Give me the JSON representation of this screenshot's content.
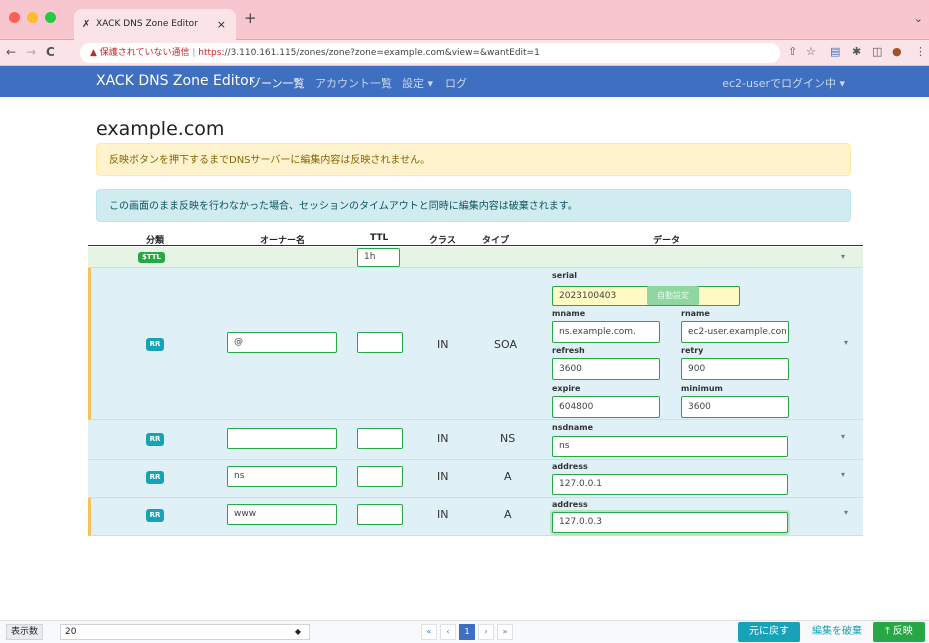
{
  "browser": {
    "tab_title": "XACK DNS Zone Editor",
    "tab_close": "×",
    "new_tab": "+",
    "warning": "保護されていない通信",
    "url_https": "https",
    "url_rest": "://3.110.161.115/zones/zone?zone=example.com&view=&wantEdit=1",
    "back": "←",
    "forward": "→",
    "reload": "C"
  },
  "nav": {
    "brand": "XACK DNS Zone Editor",
    "links": [
      "ゾーン一覧",
      "アカウント一覧",
      "設定 ▾",
      "ログ"
    ],
    "user": "ec2-userでログイン中 ▾"
  },
  "page": {
    "title": "example.com",
    "alert_warning": "反映ボタンを押下するまでDNSサーバーに編集内容は反映されません。",
    "alert_info": "この画面のまま反映を行わなかった場合、セッションのタイムアウトと同時に編集内容は破棄されます。"
  },
  "table": {
    "headers": {
      "kind": "分類",
      "owner": "オーナー名",
      "ttl": "TTL",
      "class": "クラス",
      "type": "タイプ",
      "data": "データ"
    },
    "ttl_row": {
      "badge": "$TTL",
      "value": "1h"
    },
    "soa": {
      "badge": "RR",
      "owner": "@",
      "ttl": "",
      "class": "IN",
      "type": "SOA",
      "labels": {
        "serial": "serial",
        "mname": "mname",
        "rname": "rname",
        "refresh": "refresh",
        "retry": "retry",
        "expire": "expire",
        "minimum": "minimum"
      },
      "serial": "2023100403",
      "auto": "自動設定",
      "mname": "ns.example.com.",
      "rname": "ec2-user.example.con",
      "refresh": "3600",
      "retry": "900",
      "expire": "604800",
      "minimum": "3600"
    },
    "ns": {
      "badge": "RR",
      "owner": "",
      "ttl": "",
      "class": "IN",
      "type": "NS",
      "label": "nsdname",
      "value": "ns"
    },
    "a1": {
      "badge": "RR",
      "owner": "ns",
      "ttl": "",
      "class": "IN",
      "type": "A",
      "label": "address",
      "value": "127.0.0.1"
    },
    "a2": {
      "badge": "RR",
      "owner": "www",
      "ttl": "",
      "class": "IN",
      "type": "A",
      "label": "address",
      "value": "127.0.0.3"
    }
  },
  "footer": {
    "per_page_label": "表示数",
    "per_page": "20",
    "pages": [
      "«",
      "‹",
      "1",
      "›",
      "»"
    ],
    "revert": "元に戻す",
    "discard": "編集を破棄",
    "apply": "反映"
  }
}
